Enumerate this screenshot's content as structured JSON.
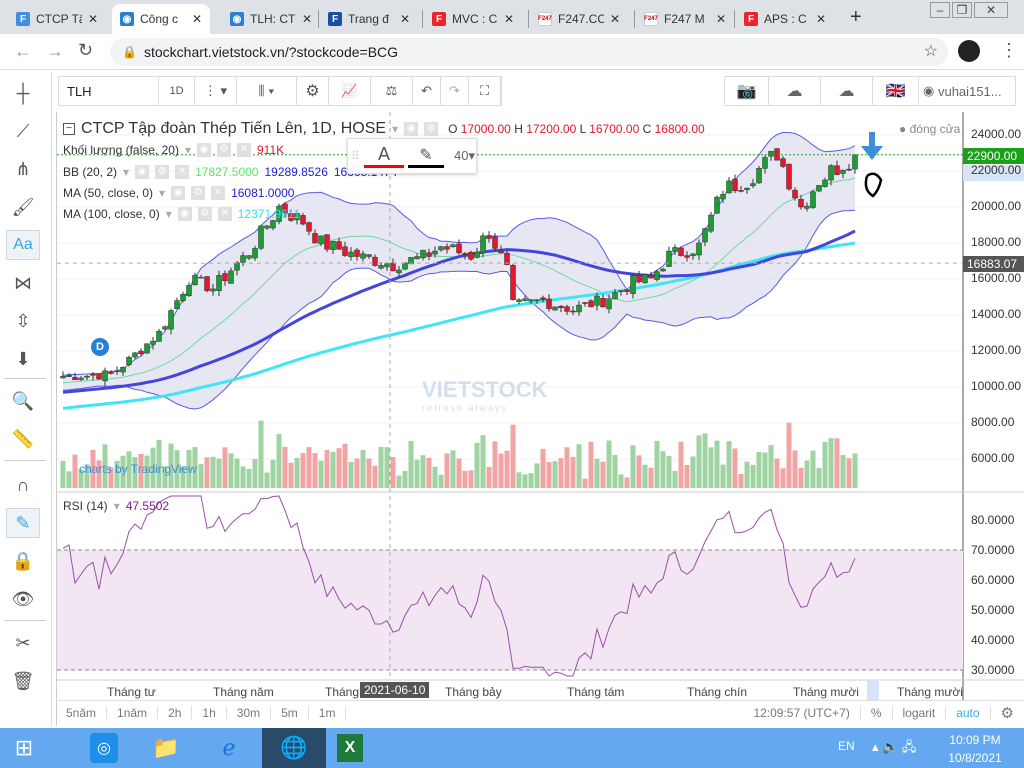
{
  "browser": {
    "tabs": [
      {
        "label": "CTCP Tậ",
        "icon": "F",
        "color": "#3d8fe0"
      },
      {
        "label": "Công c",
        "icon": "◉",
        "color": "#2a7fd4",
        "active": true
      },
      {
        "label": "TLH: CT",
        "icon": "◉",
        "color": "#2a7fd4"
      },
      {
        "label": "Trang đ",
        "icon": "F",
        "color": "#1a4fa0"
      },
      {
        "label": "MVC : C",
        "icon": "F",
        "color": "#e8242c"
      },
      {
        "label": "F247.CC",
        "icon": "F247",
        "color": "#ffffff"
      },
      {
        "label": "F247 M",
        "icon": "F247",
        "color": "#ffffff"
      },
      {
        "label": "APS : C",
        "icon": "F",
        "color": "#e8242c"
      }
    ],
    "new_tab": "+",
    "url": "stockchart.vietstock.vn/?stockcode=BCG"
  },
  "toolbar": {
    "symbol": "TLH",
    "interval": "1D",
    "user": "vuhai151..."
  },
  "legend": {
    "title": "CTCP Tập đoàn Thép Tiến Lên, 1D, HOSE",
    "o_label": "O",
    "o": "17000.00",
    "h_label": "H",
    "h": "17200.00",
    "l_label": "L",
    "l": "16700.00",
    "c_label": "C",
    "c": "16800.00",
    "volume_label": "Khối lượng (false, 20)",
    "volume_value": "911K",
    "bb_label": "BB (20, 2)",
    "bb_v1": "17827.5000",
    "bb_v2": "19289.8526",
    "bb_v3": "16365.1474",
    "ma50_label": "MA (50, close, 0)",
    "ma50_value": "16081.0000",
    "ma100_label": "MA (100, close, 0)",
    "ma100_value": "12371.9611",
    "close_toggle": "đóng cửa",
    "rsi_label": "RSI (14)",
    "rsi_value": "47.5502"
  },
  "text_tool": {
    "font_size": "40",
    "text_color": "#ff0000",
    "line_color": "#000000"
  },
  "price_axis": {
    "labels": [
      "24000.00",
      "22000.00",
      "20000.00",
      "18000.00",
      "16000.00",
      "14000.00",
      "12000.00",
      "10000.00",
      "8000.00",
      "6000.00"
    ],
    "last_price": "22900.00",
    "crosshair_price": "16883.07"
  },
  "rsi_axis": {
    "labels": [
      "80.0000",
      "70.0000",
      "60.0000",
      "50.0000",
      "40.0000",
      "30.0000"
    ]
  },
  "time_axis": {
    "labels": [
      "Tháng tư",
      "Tháng năm",
      "Tháng",
      "Tháng bảy",
      "Tháng tám",
      "Tháng chín",
      "Tháng mười",
      "Tháng mười"
    ],
    "crosshair_date": "2021-06-10"
  },
  "bottom_bar": {
    "ranges": [
      "5năm",
      "1năm",
      "2h",
      "1h",
      "30m",
      "5m",
      "1m"
    ],
    "clock": "12:09:57 (UTC+7)",
    "percent": "%",
    "log": "logarit",
    "auto": "auto"
  },
  "watermark": {
    "brand": "VIETSTOCK",
    "tagline": "refresh always"
  },
  "tradingview_credit": "charts by TradingView",
  "marker": "D",
  "taskbar": {
    "lang": "EN",
    "time": "10:09 PM",
    "date": "10/8/2021"
  },
  "colors": {
    "up": "#1a9e33",
    "down": "#e5162d",
    "bb": "#5a5ae6",
    "ma50": "#4545dd",
    "ma100": "#3ee6f5",
    "basis": "#70d8a0"
  },
  "chart_data": {
    "type": "candlestick",
    "note": "approximate close path by trading-day index",
    "close_keypoints": [
      [
        0,
        10600
      ],
      [
        8,
        10700
      ],
      [
        11,
        11500
      ],
      [
        16,
        13000
      ],
      [
        21,
        16000
      ],
      [
        25,
        15500
      ],
      [
        31,
        17500
      ],
      [
        36,
        20000
      ],
      [
        40,
        19200
      ],
      [
        43,
        18000
      ],
      [
        50,
        17200
      ],
      [
        55,
        16800
      ],
      [
        60,
        17200
      ],
      [
        63,
        17800
      ],
      [
        68,
        17300
      ],
      [
        71,
        18600
      ],
      [
        74,
        16500
      ],
      [
        75,
        14500
      ],
      [
        80,
        14800
      ],
      [
        85,
        14300
      ],
      [
        90,
        14800
      ],
      [
        95,
        15800
      ],
      [
        98,
        16000
      ],
      [
        101,
        17300
      ],
      [
        106,
        17800
      ],
      [
        110,
        21000
      ],
      [
        114,
        21500
      ],
      [
        119,
        23000
      ],
      [
        123,
        20000
      ],
      [
        126,
        21500
      ],
      [
        132,
        22900
      ]
    ],
    "ylim": [
      4500,
      25000
    ]
  }
}
